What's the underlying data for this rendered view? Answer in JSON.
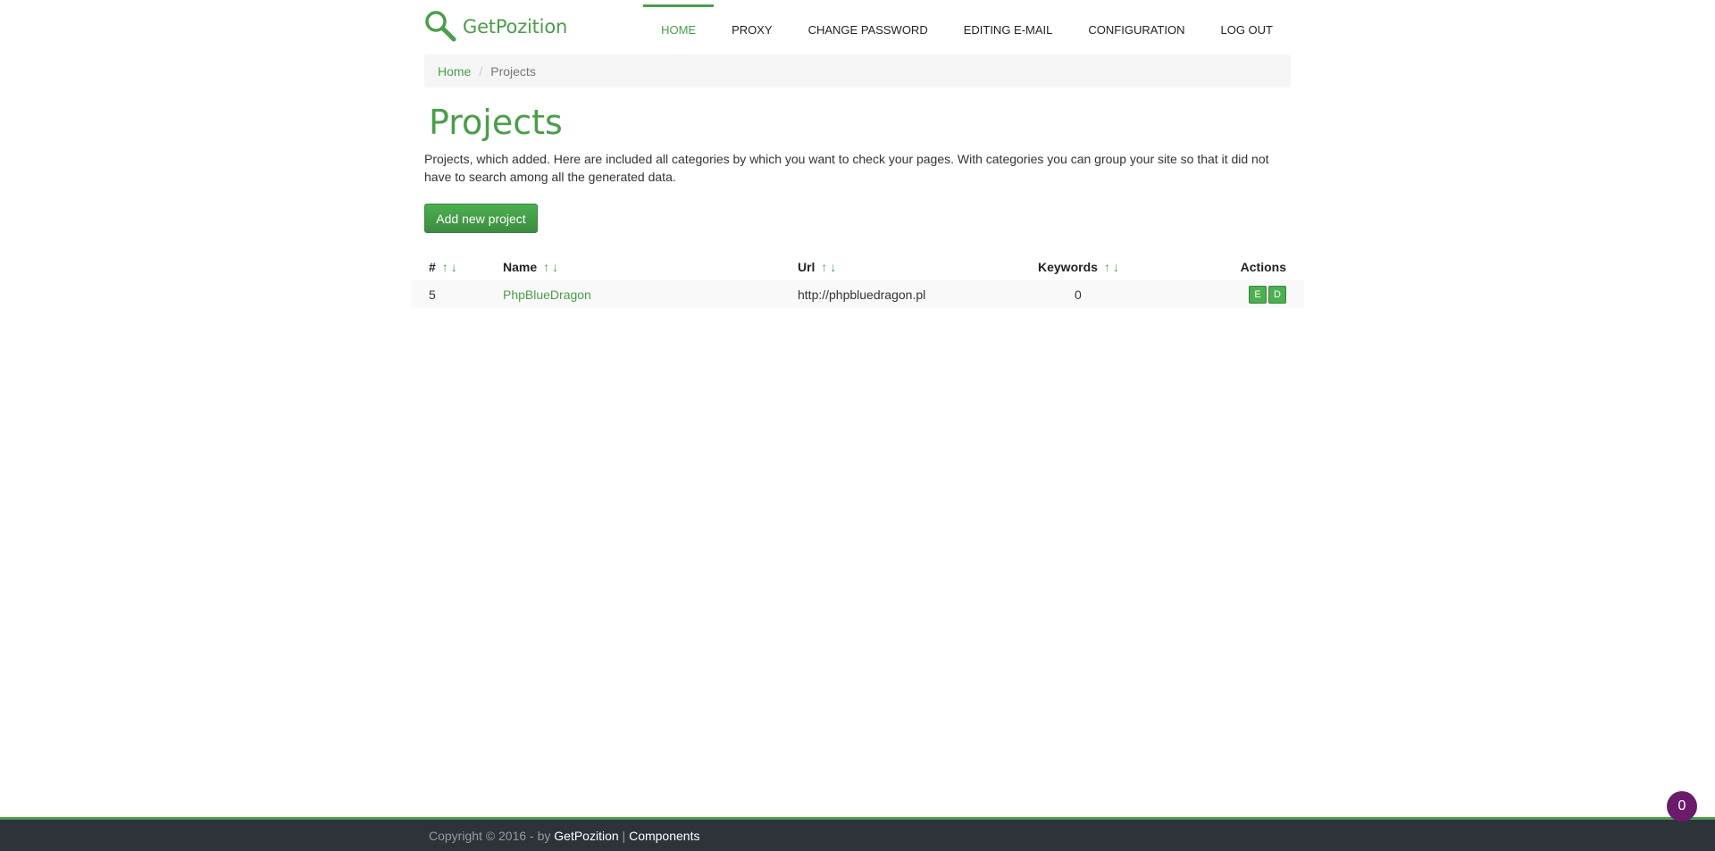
{
  "brand": {
    "name": "GetPozition",
    "accent": "#4a9e4a"
  },
  "nav": [
    {
      "label": "HOME",
      "active": true
    },
    {
      "label": "PROXY"
    },
    {
      "label": "CHANGE PASSWORD"
    },
    {
      "label": "EDITING E-MAIL"
    },
    {
      "label": "CONFIGURATION"
    },
    {
      "label": "LOG OUT"
    }
  ],
  "breadcrumb": {
    "home": "Home",
    "separator": "/",
    "current": "Projects"
  },
  "page": {
    "title": "Projects",
    "description": "Projects, which added. Here are included all categories by which you want to check your pages. With categories you can group your site so that it did not have to search among all the generated data.",
    "add_button": "Add new project"
  },
  "table": {
    "headers": {
      "id": "#",
      "name": "Name",
      "url": "Url",
      "keywords": "Keywords",
      "actions": "Actions"
    },
    "sort_up": "↑",
    "sort_down": "↓",
    "rows": [
      {
        "id": "5",
        "name": "PhpBlueDragon",
        "url": "http://phpbluedragon.pl",
        "keywords": "0",
        "edit": "E",
        "delete": "D"
      }
    ]
  },
  "footer": {
    "prefix": "Copyright © 2016 - by",
    "brand_link": "GetPozition",
    "divider": "|",
    "components_link": "Components"
  },
  "badge": {
    "count": "0",
    "color": "#6a1b6a"
  }
}
